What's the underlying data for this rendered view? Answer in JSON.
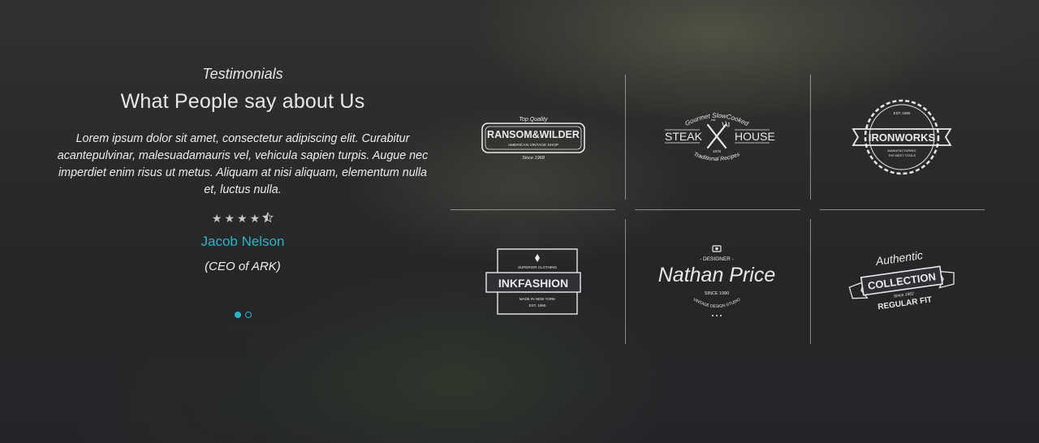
{
  "testimonial": {
    "subtitle": "Testimonials",
    "title": "What People say about Us",
    "quote": "Lorem ipsum dolor sit amet, consectetur adipiscing elit. Curabitur acantepulvinar, malesuadamauris vel, vehicula sapien turpis. Augue nec imperdiet enim risus ut metus. Aliquam at nisi aliquam, elementum nulla et, luctus nulla.",
    "rating": 4.5,
    "rating_max": 5,
    "name": "Jacob Nelson",
    "role": "(CEO of ARK)",
    "slide_index": 1,
    "slide_count": 2
  },
  "logos": [
    {
      "name": "RANSOM&WILDER",
      "top": "Top Quality",
      "sub": "AMERICAN VINTAGE SHOP",
      "bottom": "Since 1968"
    },
    {
      "name_left": "STEAK",
      "name_right": "HOUSE",
      "top": "Gourmet SlowCooked",
      "est": "est.",
      "year": "1978",
      "bottom": "Traditional Recipes"
    },
    {
      "name": "IRONWORKS",
      "top": "EST. 1990",
      "sub1": "MANUFACTURING",
      "sub2": "THE BEST TOOLS"
    },
    {
      "name": "INKFASHION",
      "top": "SUPERIOR CLOTHING",
      "sub": "MADE IN NEW YORK",
      "year": "EST. 1990"
    },
    {
      "name": "Nathan Price",
      "top": "- DESIGNER -",
      "sub": "SINCE 1990",
      "bottom": "VINTAGE DESIGN STUDIO"
    },
    {
      "top": "Authentic",
      "name": "COLLECTION",
      "year": "Since 1962",
      "bottom": "REGULAR FIT"
    }
  ],
  "colors": {
    "accent": "#2ab3c8",
    "text": "#e8e8e8",
    "divider": "#dcdcdc"
  }
}
